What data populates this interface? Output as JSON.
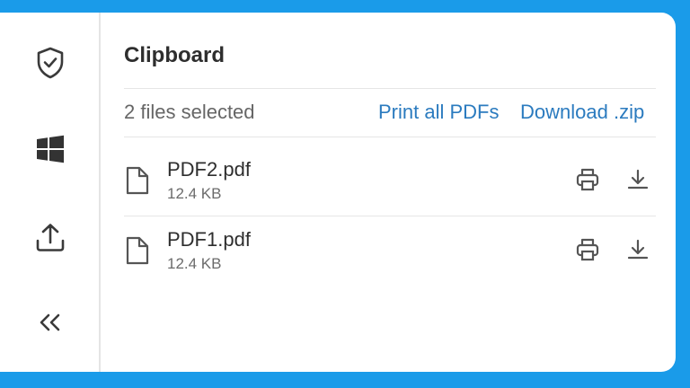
{
  "sidebar": {
    "items": [
      {
        "icon": "shield-check-icon"
      },
      {
        "icon": "windows-icon"
      },
      {
        "icon": "upload-icon"
      },
      {
        "icon": "collapse-double-chevron-icon"
      }
    ]
  },
  "clipboard": {
    "title": "Clipboard",
    "selection_count": "2 files selected",
    "print_all_label": "Print all PDFs",
    "download_zip_label": "Download .zip"
  },
  "files": [
    {
      "name": "PDF2.pdf",
      "size": "12.4 KB"
    },
    {
      "name": "PDF1.pdf",
      "size": "12.4 KB"
    }
  ],
  "colors": {
    "background": "#1a9be9",
    "link": "#2b7bbf",
    "icon": "#4a4a4a"
  }
}
